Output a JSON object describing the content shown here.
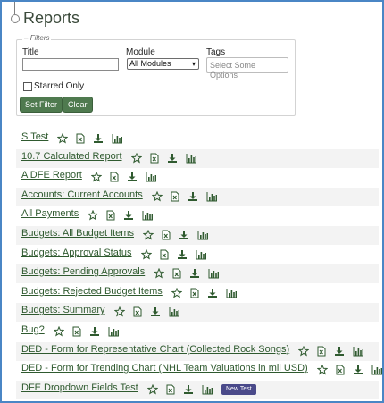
{
  "page": {
    "title": "Reports"
  },
  "filters": {
    "legend": "Filters",
    "title_label": "Title",
    "title_value": "",
    "module_label": "Module",
    "module_selected": "All Modules",
    "tags_label": "Tags",
    "tags_placeholder": "Select Some Options",
    "starred_label": "Starred Only",
    "starred_checked": false,
    "set_filter_label": "Set Filter",
    "clear_label": "Clear"
  },
  "colors": {
    "accent": "#4f7a4f",
    "link": "#2f5a2f",
    "badge": "#4a4a8a",
    "frame": "#4a86c5"
  },
  "icons": [
    "star-icon",
    "excel-icon",
    "download-icon",
    "chart-icon"
  ],
  "reports": [
    {
      "name": "S Test",
      "badge": ""
    },
    {
      "name": "10.7 Calculated Report",
      "badge": ""
    },
    {
      "name": "A DFE Report",
      "badge": ""
    },
    {
      "name": "Accounts: Current Accounts",
      "badge": ""
    },
    {
      "name": "All Payments",
      "badge": ""
    },
    {
      "name": "Budgets: All Budget Items",
      "badge": ""
    },
    {
      "name": "Budgets: Approval Status",
      "badge": ""
    },
    {
      "name": "Budgets: Pending Approvals",
      "badge": ""
    },
    {
      "name": "Budgets: Rejected Budget Items",
      "badge": ""
    },
    {
      "name": "Budgets: Summary",
      "badge": ""
    },
    {
      "name": "Bug?",
      "badge": ""
    },
    {
      "name": "DED - Form for Representative Chart (Collected Rock Songs)",
      "badge": ""
    },
    {
      "name": "DED - Form for Trending Chart (NHL Team Valuations in mil USD)",
      "badge": ""
    },
    {
      "name": "DFE Dropdown Fields Test",
      "badge": "New Test"
    }
  ]
}
